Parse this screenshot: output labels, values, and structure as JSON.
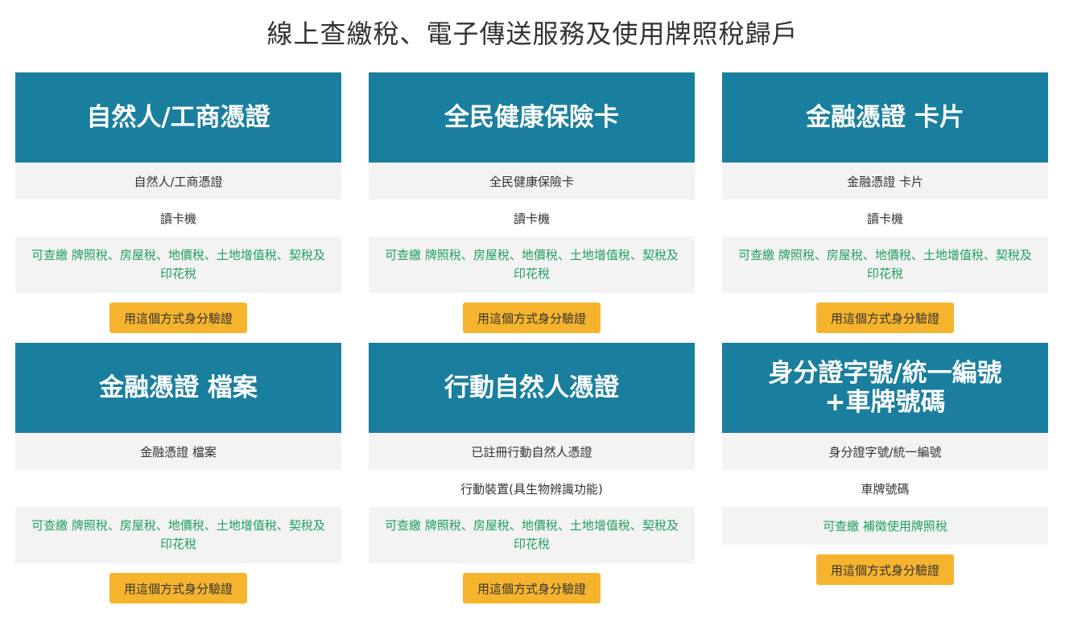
{
  "page_title": "線上查繳稅、電子傳送服務及使用牌照稅歸戶",
  "colors": {
    "card_header": "#1a7f9e",
    "button": "#f6b42e",
    "green_text": "#1f9e5e",
    "row_gray": "#f3f3f3"
  },
  "cards": [
    {
      "title_lines": [
        "自然人/工商憑證"
      ],
      "credential": "自然人/工商憑證",
      "device": "讀卡機",
      "services": [
        "可查繳 牌照稅、房屋稅、地價稅、土地增值稅、契稅及",
        "印花稅"
      ],
      "button": "用這個方式身分驗證"
    },
    {
      "title_lines": [
        "全民健康保險卡"
      ],
      "credential": "全民健康保險卡",
      "device": "讀卡機",
      "services": [
        "可查繳 牌照稅、房屋稅、地價稅、土地增值稅、契稅及",
        "印花稅"
      ],
      "button": "用這個方式身分驗證"
    },
    {
      "title_lines": [
        "金融憑證 卡片"
      ],
      "credential": "金融憑證 卡片",
      "device": "讀卡機",
      "services": [
        "可查繳 牌照稅、房屋稅、地價稅、土地增值稅、契稅及",
        "印花稅"
      ],
      "button": "用這個方式身分驗證"
    },
    {
      "title_lines": [
        "金融憑證 檔案"
      ],
      "credential": "金融憑證 檔案",
      "device": "",
      "services": [
        "可查繳 牌照稅、房屋稅、地價稅、土地增值稅、契稅及",
        "印花稅"
      ],
      "button": "用這個方式身分驗證"
    },
    {
      "title_lines": [
        "行動自然人憑證"
      ],
      "credential": "已註冊行動自然人憑證",
      "device": "行動裝置(具生物辨識功能)",
      "services": [
        "可查繳 牌照稅、房屋稅、地價稅、土地增值稅、契稅及",
        "印花稅"
      ],
      "button": "用這個方式身分驗證"
    },
    {
      "title_lines": [
        "身分證字號/統一編號",
        "+車牌號碼"
      ],
      "credential": "身分證字號/統一編號",
      "device": "車牌號碼",
      "services": [
        "可查繳 補徵使用牌照稅"
      ],
      "button": "用這個方式身分驗證"
    }
  ]
}
